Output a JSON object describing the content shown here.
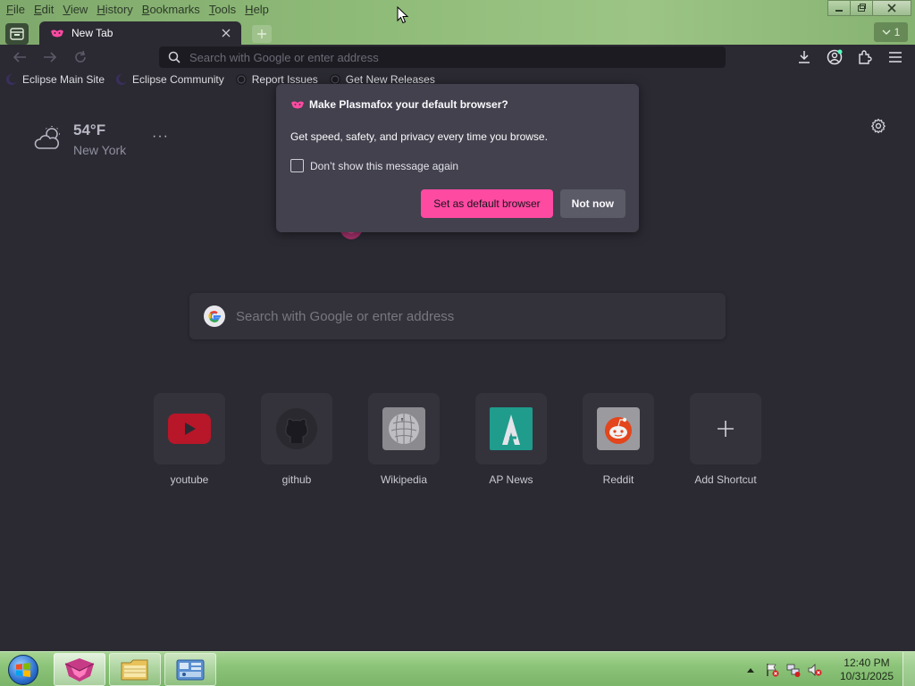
{
  "menu": {
    "items": [
      {
        "key": "F",
        "rest": "ile"
      },
      {
        "key": "E",
        "rest": "dit"
      },
      {
        "key": "V",
        "rest": "iew"
      },
      {
        "key": "H",
        "rest": "istory"
      },
      {
        "key": "B",
        "rest": "ookmarks"
      },
      {
        "key": "T",
        "rest": "ools"
      },
      {
        "key": "H",
        "rest": "elp"
      }
    ]
  },
  "tabs": {
    "active_title": "New Tab",
    "count": "1"
  },
  "urlbar": {
    "placeholder": "Search with Google or enter address"
  },
  "bookmarks": [
    {
      "label": "Eclipse Main Site",
      "icon": "eclipse-icon"
    },
    {
      "label": "Eclipse Community",
      "icon": "eclipse-icon"
    },
    {
      "label": "Report Issues",
      "icon": "github-icon"
    },
    {
      "label": "Get New Releases",
      "icon": "github-icon"
    }
  ],
  "weather": {
    "temperature": "54°F",
    "city": "New York",
    "more": "···"
  },
  "search": {
    "placeholder": "Search with Google or enter address"
  },
  "shortcuts": [
    {
      "label": "youtube",
      "icon": "youtube-icon"
    },
    {
      "label": "github",
      "icon": "github-icon"
    },
    {
      "label": "Wikipedia",
      "icon": "wikipedia-icon"
    },
    {
      "label": "AP News",
      "icon": "apnews-icon"
    },
    {
      "label": "Reddit",
      "icon": "reddit-icon"
    },
    {
      "label": "Add Shortcut",
      "icon": "plus-icon"
    }
  ],
  "popup": {
    "title": "Make Plasmafox your default browser?",
    "body": "Get speed, safety, and privacy every time you browse.",
    "checkbox_label": "Don’t show this message again",
    "primary_button": "Set as default browser",
    "secondary_button": "Not now"
  },
  "taskbar": {
    "time": "12:40 PM",
    "date": "10/31/2025"
  },
  "colors": {
    "accent": "#ff4aa2",
    "background": "#2b2a33",
    "popup": "#42414d"
  }
}
